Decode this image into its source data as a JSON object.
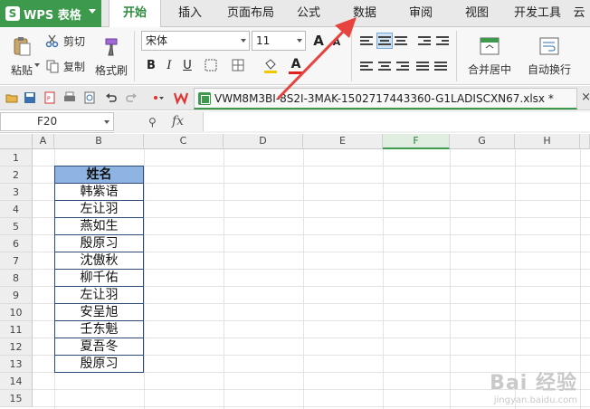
{
  "app": {
    "title": "WPS 表格",
    "logo_letter": "S"
  },
  "menu_tabs": [
    {
      "label": "开始",
      "active": true
    },
    {
      "label": "插入",
      "active": false
    },
    {
      "label": "页面布局",
      "active": false
    },
    {
      "label": "公式",
      "active": false
    },
    {
      "label": "数据",
      "active": false
    },
    {
      "label": "审阅",
      "active": false
    },
    {
      "label": "视图",
      "active": false
    },
    {
      "label": "开发工具",
      "active": false
    },
    {
      "label": "云",
      "active": false
    }
  ],
  "ribbon": {
    "paste_label": "粘贴",
    "cut_label": "剪切",
    "copy_label": "复制",
    "format_painter_label": "格式刷",
    "font_name": "宋体",
    "font_size": "11",
    "bold": "B",
    "italic": "I",
    "underline": "U",
    "font_color_letter": "A",
    "grow_font": "A",
    "shrink_font": "A",
    "merge_center_label": "合并居中",
    "wrap_text_label": "自动换行"
  },
  "document": {
    "tab_name": "VWM8M3BI-8S2I-3MAK-1502717443360-G1LADISCXN67.xlsx *",
    "close": "×"
  },
  "formula_bar": {
    "cell_ref": "F20",
    "fx": "fx",
    "zoom_glyph": "⚲"
  },
  "sheet": {
    "columns": [
      "A",
      "B",
      "C",
      "D",
      "E",
      "F",
      "G",
      "H"
    ],
    "selected_column": "F",
    "rows": [
      "1",
      "2",
      "3",
      "4",
      "5",
      "6",
      "7",
      "8",
      "9",
      "10",
      "11",
      "12",
      "13",
      "14",
      "15"
    ],
    "table_header": "姓名",
    "names": [
      "韩紫语",
      "左让羽",
      "燕如生",
      "殷原习",
      "沈傲秋",
      "柳千佑",
      "左让羽",
      "安呈旭",
      "壬东魁",
      "夏吾冬",
      "殷原习"
    ]
  },
  "colors": {
    "brand_green": "#3d9a4c",
    "header_fill": "#8db4e2",
    "arrow_red": "#e8423f"
  },
  "watermark": {
    "main": "Bai 经验",
    "sub": "jingyan.baidu.com"
  }
}
